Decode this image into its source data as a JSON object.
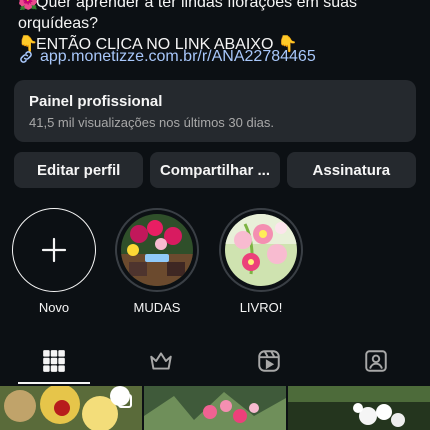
{
  "bio": {
    "line1": "Quer aprender a ter lindas florações em suas",
    "line1_emoji": "🌺",
    "line2": "orquídeas?",
    "line3_emoji": "👇",
    "line3": "ENTÃO CLICA NO LINK ABAIXO",
    "line3_end_emoji": "👇",
    "link": "app.monetizze.com.br/r/ANA22784465"
  },
  "panel": {
    "title": "Painel profissional",
    "subtitle": "41,5 mil visualizações nos últimos 30 dias."
  },
  "buttons": {
    "edit": "Editar perfil",
    "share": "Compartilhar ...",
    "subscription": "Assinatura"
  },
  "highlights": [
    {
      "label": "Novo",
      "icon": "plus-icon"
    },
    {
      "label": "MUDAS"
    },
    {
      "label": "LIVRO!"
    }
  ],
  "tabs": [
    {
      "icon": "grid-icon",
      "active": true
    },
    {
      "icon": "crown-icon",
      "active": false
    },
    {
      "icon": "reels-icon",
      "active": false
    },
    {
      "icon": "tagged-icon",
      "active": false
    }
  ],
  "colors": {
    "background": "#0c1014",
    "surface": "#25292e",
    "link": "#a8c7fa",
    "muted": "#a8a8a8"
  }
}
